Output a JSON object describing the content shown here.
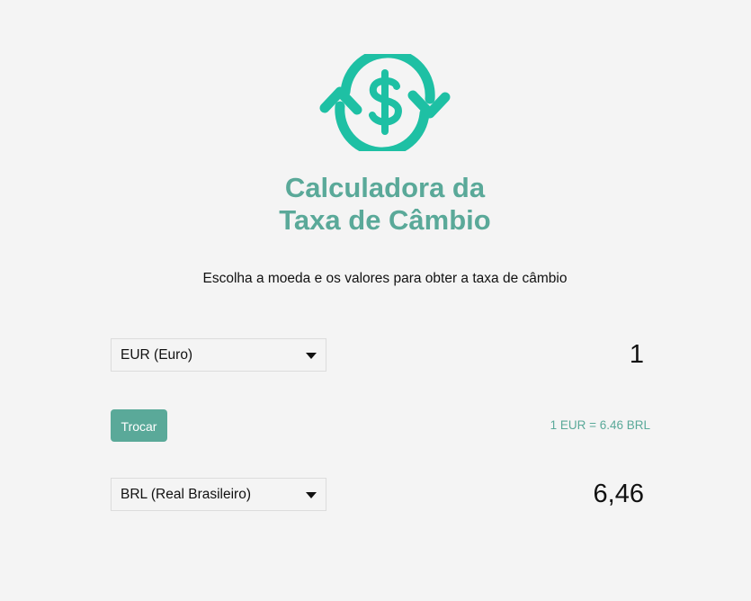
{
  "header": {
    "title_line1": "Calculadora da",
    "title_line2": "Taxa de Câmbio",
    "subtitle": "Escolha a moeda e os valores para obter a taxa de câmbio"
  },
  "converter": {
    "from_currency": "EUR (Euro)",
    "from_amount": "1",
    "swap_label": "Trocar",
    "rate_text": "1 EUR = 6.46 BRL",
    "to_currency": "BRL (Real Brasileiro)",
    "to_amount": "6,46"
  },
  "colors": {
    "accent": "#5aa999",
    "logo": "#1ec0a4",
    "background": "#f4f4f4"
  },
  "icons": {
    "logo": "currency-exchange-icon",
    "dropdown": "caret-down-icon"
  }
}
